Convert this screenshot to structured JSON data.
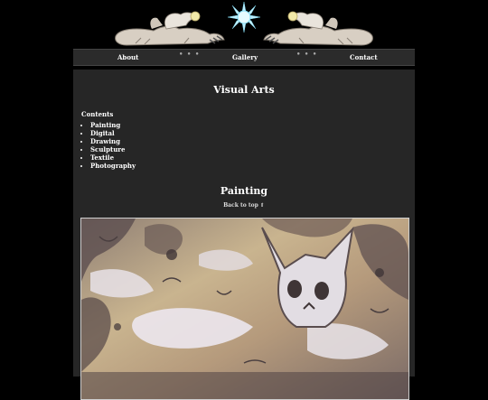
{
  "nav": {
    "about": "About",
    "gallery": "Gallery",
    "contact": "Contact",
    "separator": "• • •"
  },
  "page_title": "Visual Arts",
  "contents_label": "Contents",
  "toc": [
    "Painting",
    "Digital",
    "Drawing",
    "Sculpture",
    "Textile",
    "Photography"
  ],
  "section": {
    "title": "Painting",
    "back_to_top": "Back to top ⇑"
  },
  "colors": {
    "background": "#000000",
    "panel": "#262626",
    "nav_bar": "#2b2b2b",
    "sun": "#bfefff"
  }
}
